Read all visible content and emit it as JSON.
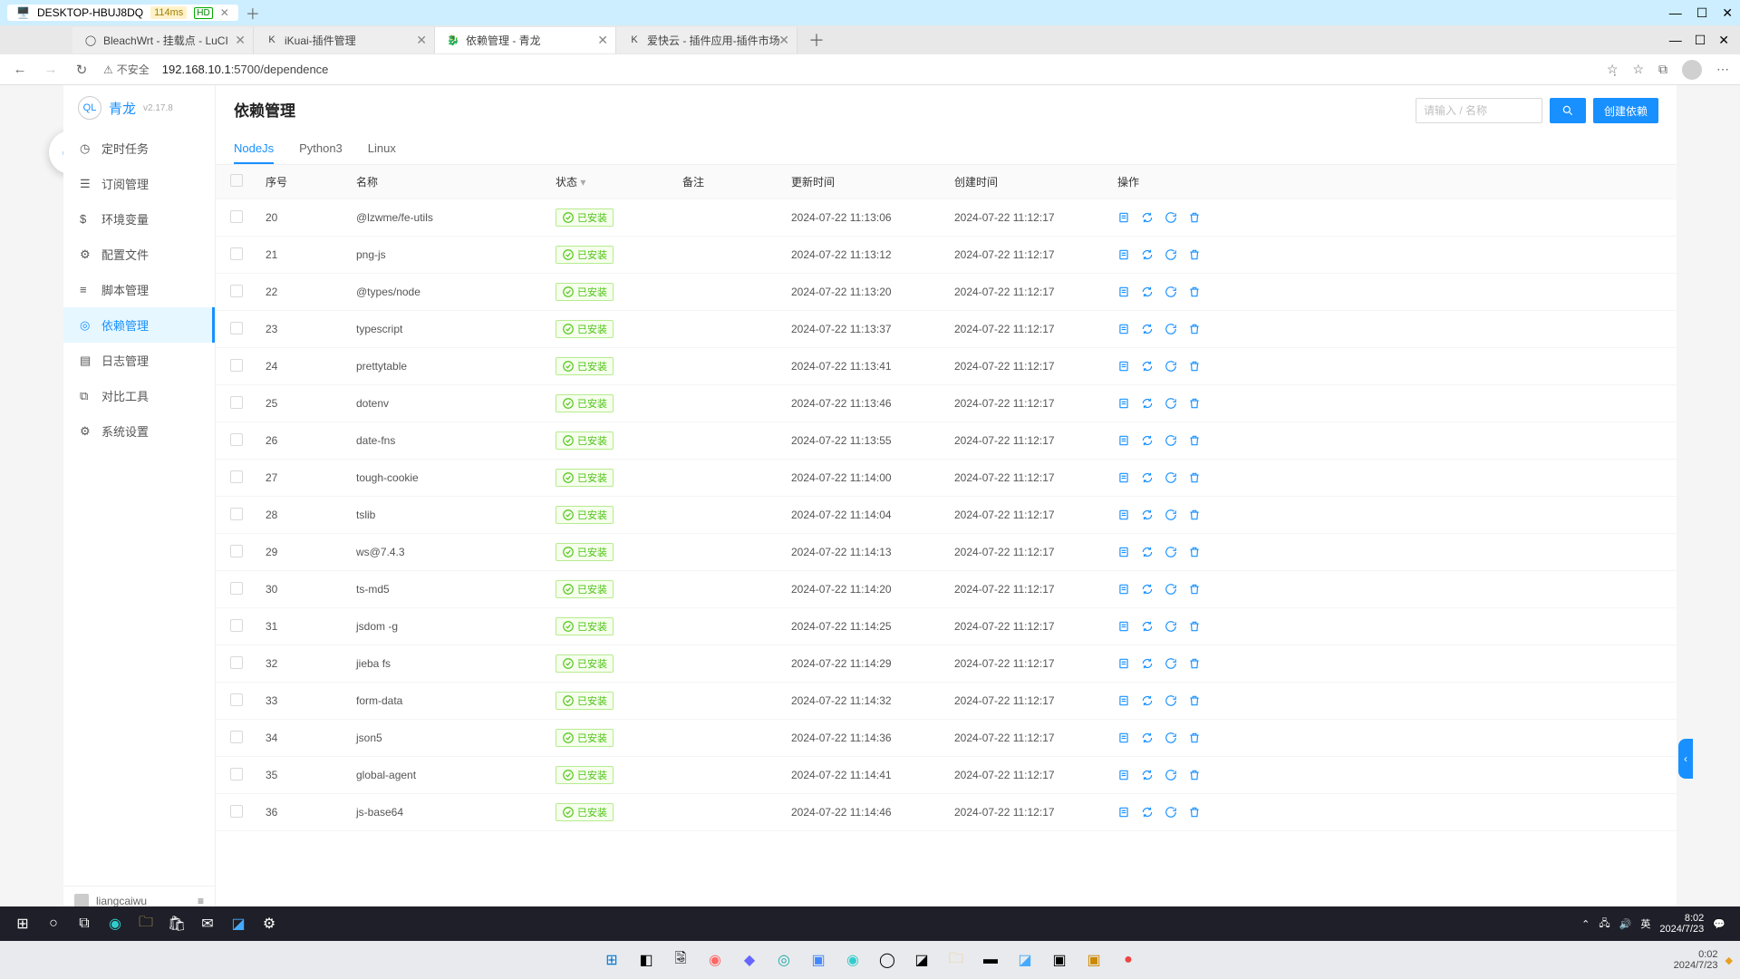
{
  "window": {
    "title": "DESKTOP-HBUJ8DQ",
    "latency": "114ms",
    "hd": "HD"
  },
  "browser_tabs": [
    {
      "title": "BleachWrt - 挂载点 - LuCI",
      "favicon": "◯"
    },
    {
      "title": "iKuai-插件管理",
      "favicon": "K"
    },
    {
      "title": "依赖管理 - 青龙",
      "favicon": "🐉",
      "active": true
    },
    {
      "title": "爱快云 - 插件应用-插件市场",
      "favicon": "K"
    }
  ],
  "address_bar": {
    "security": "不安全",
    "url_host": "192.168.10.1",
    "url_rest": ":5700/dependence"
  },
  "brand": {
    "name": "青龙",
    "version": "v2.17.8"
  },
  "sidebar": {
    "items": [
      {
        "icon": "◷",
        "label": "定时任务"
      },
      {
        "icon": "☰",
        "label": "订阅管理"
      },
      {
        "icon": "$",
        "label": "环境变量"
      },
      {
        "icon": "⚙",
        "label": "配置文件"
      },
      {
        "icon": "≡",
        "label": "脚本管理"
      },
      {
        "icon": "◎",
        "label": "依赖管理",
        "active": true
      },
      {
        "icon": "▤",
        "label": "日志管理"
      },
      {
        "icon": "⧉",
        "label": "对比工具"
      },
      {
        "icon": "⚙",
        "label": "系统设置"
      }
    ],
    "footer_user": "liangcaiwu"
  },
  "page": {
    "title": "依赖管理",
    "search_placeholder": "请输入 / 名称",
    "create_btn": "创建依赖",
    "tabs": [
      "NodeJs",
      "Python3",
      "Linux"
    ],
    "active_tab": 0
  },
  "table": {
    "columns": {
      "seq": "序号",
      "name": "名称",
      "status": "状态",
      "note": "备注",
      "update": "更新时间",
      "create": "创建时间",
      "action": "操作"
    },
    "status_text": "已安装",
    "rows": [
      {
        "seq": 20,
        "name": "@lzwme/fe-utils",
        "update": "2024-07-22 11:13:06",
        "create": "2024-07-22 11:12:17"
      },
      {
        "seq": 21,
        "name": "png-js",
        "update": "2024-07-22 11:13:12",
        "create": "2024-07-22 11:12:17"
      },
      {
        "seq": 22,
        "name": "@types/node",
        "update": "2024-07-22 11:13:20",
        "create": "2024-07-22 11:12:17"
      },
      {
        "seq": 23,
        "name": "typescript",
        "update": "2024-07-22 11:13:37",
        "create": "2024-07-22 11:12:17"
      },
      {
        "seq": 24,
        "name": "prettytable",
        "update": "2024-07-22 11:13:41",
        "create": "2024-07-22 11:12:17"
      },
      {
        "seq": 25,
        "name": "dotenv",
        "update": "2024-07-22 11:13:46",
        "create": "2024-07-22 11:12:17"
      },
      {
        "seq": 26,
        "name": "date-fns",
        "update": "2024-07-22 11:13:55",
        "create": "2024-07-22 11:12:17"
      },
      {
        "seq": 27,
        "name": "tough-cookie",
        "update": "2024-07-22 11:14:00",
        "create": "2024-07-22 11:12:17"
      },
      {
        "seq": 28,
        "name": "tslib",
        "update": "2024-07-22 11:14:04",
        "create": "2024-07-22 11:12:17"
      },
      {
        "seq": 29,
        "name": "ws@7.4.3",
        "update": "2024-07-22 11:14:13",
        "create": "2024-07-22 11:12:17"
      },
      {
        "seq": 30,
        "name": "ts-md5",
        "update": "2024-07-22 11:14:20",
        "create": "2024-07-22 11:12:17"
      },
      {
        "seq": 31,
        "name": "jsdom -g",
        "update": "2024-07-22 11:14:25",
        "create": "2024-07-22 11:12:17"
      },
      {
        "seq": 32,
        "name": "jieba fs",
        "update": "2024-07-22 11:14:29",
        "create": "2024-07-22 11:12:17"
      },
      {
        "seq": 33,
        "name": "form-data",
        "update": "2024-07-22 11:14:32",
        "create": "2024-07-22 11:12:17"
      },
      {
        "seq": 34,
        "name": "json5",
        "update": "2024-07-22 11:14:36",
        "create": "2024-07-22 11:12:17"
      },
      {
        "seq": 35,
        "name": "global-agent",
        "update": "2024-07-22 11:14:41",
        "create": "2024-07-22 11:12:17"
      },
      {
        "seq": 36,
        "name": "js-base64",
        "update": "2024-07-22 11:14:46",
        "create": "2024-07-22 11:12:17"
      }
    ]
  },
  "taskbar": {
    "ime": "英",
    "time": "8:02",
    "date": "2024/7/23"
  },
  "taskbar2": {
    "time": "0:02",
    "date": "2024/7/23"
  }
}
